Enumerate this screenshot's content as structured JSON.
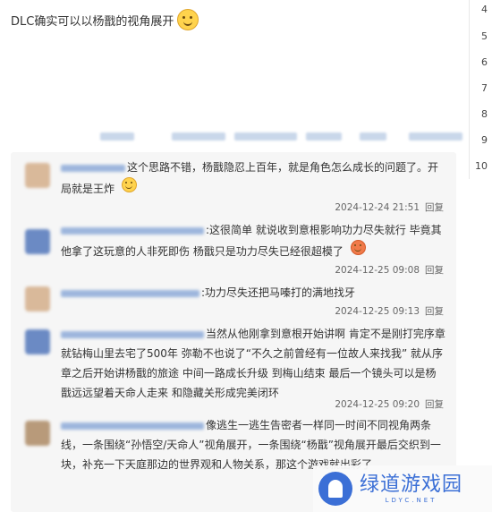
{
  "post": {
    "text": "DLC确实可以以杨戬的视角展开",
    "emoji": "smile-emoji"
  },
  "rail": {
    "numbers": [
      "4",
      "5",
      "6",
      "7",
      "8",
      "9",
      "10"
    ]
  },
  "comments": [
    {
      "text": "这个思路不错，杨戬隐忍上百年，就是角色怎么成长的问题了。开局就是王炸",
      "emoji": "grin-emoji",
      "time": "2024-12-24 21:51",
      "reply": "回复"
    },
    {
      "text": ":这很简单 就说收到意根影响功力尽失就行 毕竟其他拿了这玩意的人非死即伤 杨戬只是功力尽失已经很超模了",
      "emoji": "angry-emoji",
      "time": "2024-12-25 09:08",
      "reply": "回复"
    },
    {
      "text": ":功力尽失还把马嗪打的满地找牙",
      "time": "2024-12-25 09:13",
      "reply": "回复"
    },
    {
      "text": "当然从他刚拿到意根开始讲啊 肯定不是刚打完序章就钻梅山里去宅了500年 弥勒不也说了“不久之前曾经有一位故人来找我” 就从序章之后开始讲杨戬的旅途 中间一路成长升级 到梅山结束 最后一个镜头可以是杨戬远远望着天命人走来 和隐藏关形成完美闭环",
      "time": "2024-12-25 09:20",
      "reply": "回复"
    },
    {
      "text": "像逃生一逃生告密者一样同一时间不同视角两条线，一条围绕“孙悟空/天命人”视角展开，一条围绕“杨戬”视角展开最后交织到一块，补充一下天庭那边的世界观和人物关系，那这个游戏就出彩了"
    }
  ],
  "watermark": {
    "main": "绿道游戏园",
    "sub": "LDYC.NET"
  }
}
